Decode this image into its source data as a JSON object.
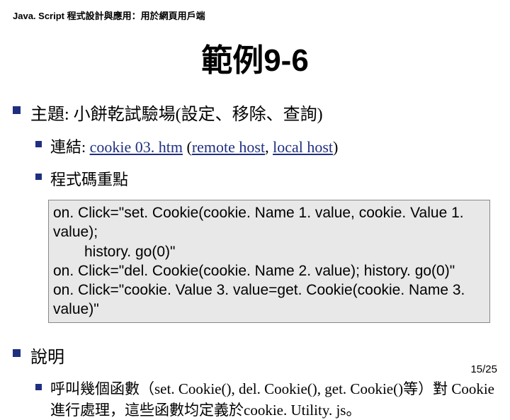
{
  "header": "Java. Script 程式設計與應用：用於網頁用戶端",
  "title_cjk": "範例",
  "title_latin": "9-6",
  "topic_label": "主題",
  "topic_text": ": 小餅乾試驗場(設定、移除、查詢)",
  "link_prefix": "連結: ",
  "links": {
    "file": "cookie 03. htm",
    "paren_open": " (",
    "remote": "remote host",
    "sep": ", ",
    "local": "local host",
    "paren_close": ")"
  },
  "code_point_label": "程式碼重點",
  "code": {
    "l1": "on. Click=\"set. Cookie(cookie. Name 1. value, cookie. Value 1. value);",
    "l2": "history. go(0)\"",
    "l3": "on. Click=\"del. Cookie(cookie. Name 2. value); history. go(0)\"",
    "l4": "on. Click=\"cookie. Value 3. value=get. Cookie(cookie. Name 3. value)\""
  },
  "explain_label": "說明",
  "explain_text": "呼叫幾個函數（set. Cookie(), del. Cookie(), get. Cookie()等）對 Cookie 進行處理，這些函數均定義於cookie. Utility. js。",
  "pager": "15/25"
}
